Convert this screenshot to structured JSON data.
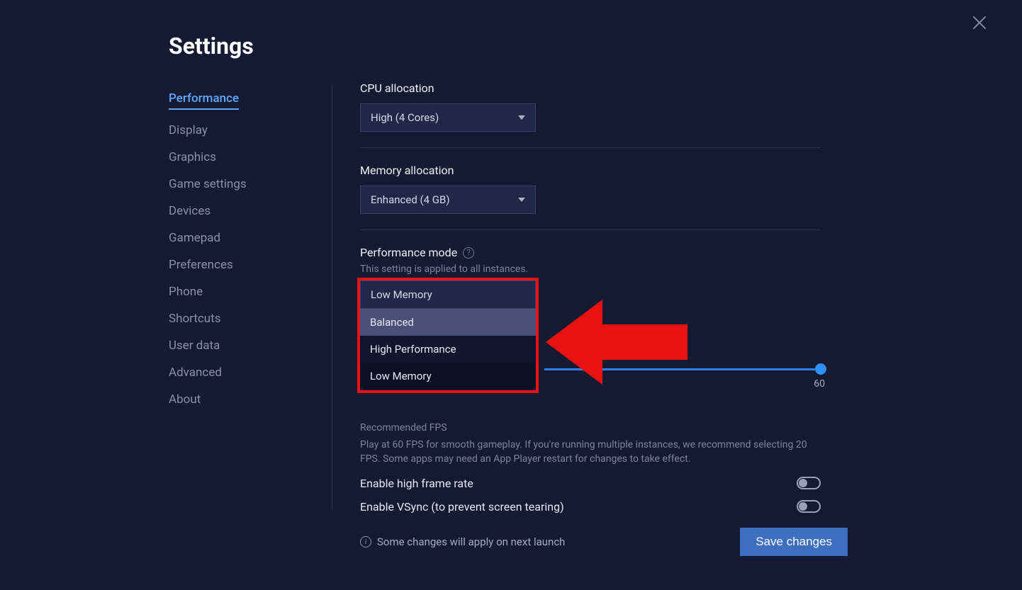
{
  "app": {
    "title": "Settings"
  },
  "sidebar": {
    "items": [
      {
        "label": "Performance",
        "active": true
      },
      {
        "label": "Display"
      },
      {
        "label": "Graphics"
      },
      {
        "label": "Game settings"
      },
      {
        "label": "Devices"
      },
      {
        "label": "Gamepad"
      },
      {
        "label": "Preferences"
      },
      {
        "label": "Phone"
      },
      {
        "label": "Shortcuts"
      },
      {
        "label": "User data"
      },
      {
        "label": "Advanced"
      },
      {
        "label": "About"
      }
    ]
  },
  "cpu": {
    "label": "CPU allocation",
    "value": "High (4 Cores)"
  },
  "mem": {
    "label": "Memory allocation",
    "value": "Enhanced (4 GB)"
  },
  "perf": {
    "label": "Performance mode",
    "hint": "This setting is applied to all instances.",
    "value": "Low Memory",
    "options": [
      "Balanced",
      "High Performance",
      "Low Memory"
    ]
  },
  "fps": {
    "slider_max": "60",
    "title": "Recommended FPS",
    "text": "Play at 60 FPS for smooth gameplay. If you're running multiple instances, we recommend selecting 20 FPS. Some apps may need an App Player restart for changes to take effect."
  },
  "toggles": {
    "hfr": "Enable high frame rate",
    "vsync": "Enable VSync (to prevent screen tearing)"
  },
  "footer": {
    "note": "Some changes will apply on next launch",
    "save": "Save changes"
  }
}
